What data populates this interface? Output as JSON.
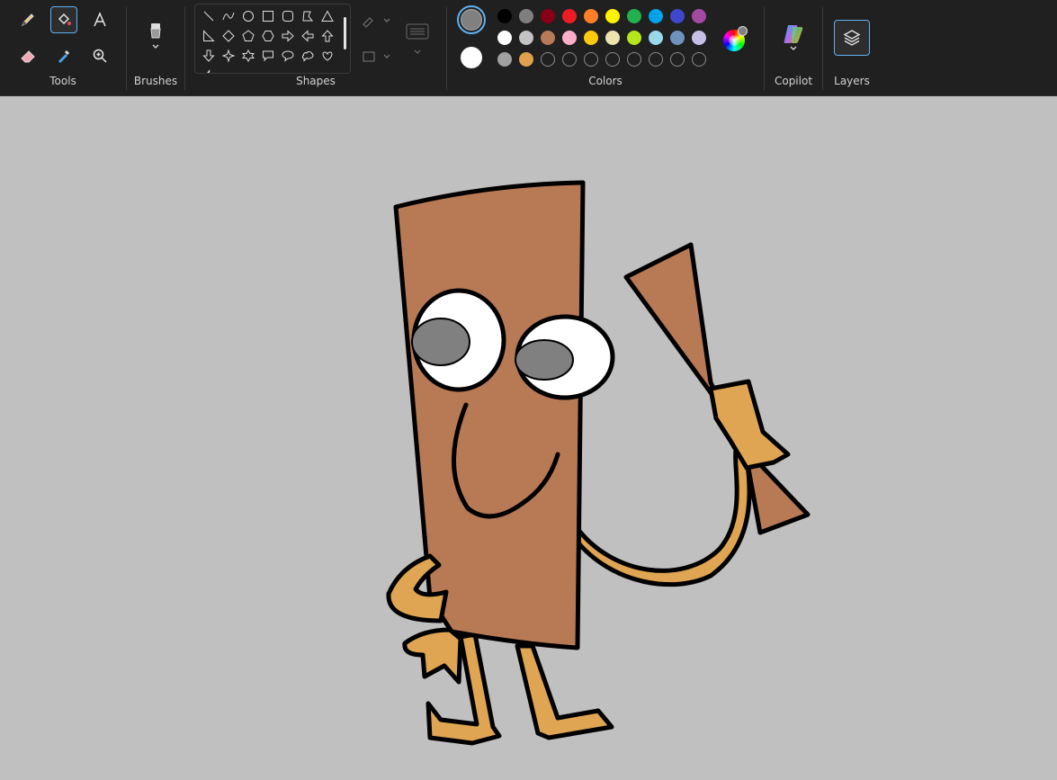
{
  "toolbar": {
    "groups": {
      "tools": "Tools",
      "brushes": "Brushes",
      "shapes": "Shapes",
      "colors": "Colors",
      "copilot": "Copilot",
      "layers": "Layers"
    }
  },
  "tools": [
    "pencil-icon",
    "fill-icon",
    "text-icon",
    "eraser-icon",
    "color-picker-icon",
    "magnifier-icon"
  ],
  "active_tool": "fill",
  "shapes": [
    "line",
    "curve",
    "oval",
    "rectangle",
    "rounded-rectangle",
    "polygon",
    "triangle",
    "right-triangle",
    "diamond",
    "pentagon",
    "hexagon",
    "right-arrow",
    "left-arrow",
    "up-arrow",
    "down-arrow",
    "four-point-star",
    "six-point-star",
    "speech-bubble-rect",
    "speech-bubble-oval",
    "speech-bubble-cloud",
    "heart",
    "lightning"
  ],
  "colors": {
    "color1": "#808080",
    "color2": "#ffffff",
    "palette": [
      [
        "#000000",
        "#7f7f7f",
        "#880015",
        "#ed1c24",
        "#ff7f27",
        "#fff200",
        "#22b14c",
        "#00a2e8",
        "#3f48cc",
        "#a349a4"
      ],
      [
        "#ffffff",
        "#c3c3c3",
        "#b97a57",
        "#ffaec9",
        "#ffc90e",
        "#efe4b0",
        "#b5e61d",
        "#99d9ea",
        "#7092be",
        "#c8bfe7"
      ],
      [
        "#a0a0a0",
        "#e0a050",
        "",
        "",
        "",
        "",
        "",
        "",
        "",
        ""
      ]
    ]
  },
  "drawing": {
    "board_color": "#b87a55",
    "hand_color": "#e0a552",
    "eye_pupil_color": "#808080"
  }
}
